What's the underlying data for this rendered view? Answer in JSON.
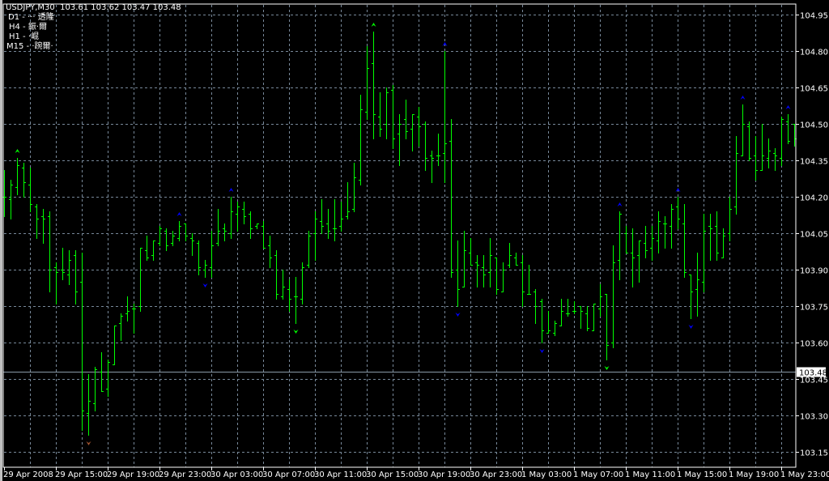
{
  "header": {
    "symbol_timeframe": "USDJPY,M30",
    "ohlc": "103.61 103.62 103.47 103.48"
  },
  "indicator_legend": [
    "D1 - ··· 透隆",
    "H4 - 鋠·爾",
    "H1 - ·崐",
    "M15 - ·踠爾·"
  ],
  "colors": {
    "background": "#000000",
    "bars": "#00ff00",
    "grid": "#778899",
    "axis": "#ffffff",
    "price_line": "#8a9aa8",
    "fractal_green": "#00ff00",
    "fractal_blue": "#0000ff",
    "fractal_brown": "#a0522d"
  },
  "price_axis": {
    "ticks": [
      "104.95",
      "104.80",
      "104.65",
      "104.50",
      "104.35",
      "104.20",
      "104.05",
      "103.90",
      "103.75",
      "103.60",
      "103.45",
      "103.30",
      "103.15"
    ],
    "current_price": "103.48"
  },
  "time_axis": {
    "labels": [
      "29 Apr 2008",
      "29 Apr 15:00",
      "29 Apr 19:00",
      "29 Apr 23:00",
      "30 Apr 03:00",
      "30 Apr 07:00",
      "30 Apr 11:00",
      "30 Apr 15:00",
      "30 Apr 19:00",
      "30 Apr 23:00",
      "1 May 03:00",
      "1 May 07:00",
      "1 May 11:00",
      "1 May 15:00",
      "1 May 19:00",
      "1 May 23:00"
    ],
    "bars_per_label": 8
  },
  "chart_data": {
    "type": "ohlc",
    "ylim": [
      103.15,
      104.95
    ],
    "grid": true,
    "bar_fields": [
      "open",
      "high",
      "low",
      "close"
    ],
    "bars": [
      [
        104.2,
        104.31,
        104.12,
        104.2
      ],
      [
        104.19,
        104.27,
        104.11,
        104.25
      ],
      [
        104.24,
        104.36,
        104.21,
        104.33
      ],
      [
        104.32,
        104.34,
        104.2,
        104.26
      ],
      [
        104.25,
        104.32,
        104.14,
        104.17
      ],
      [
        104.16,
        104.17,
        104.03,
        104.11
      ],
      [
        104.12,
        104.15,
        104.01,
        104.11
      ],
      [
        104.12,
        104.14,
        103.81,
        103.9
      ],
      [
        103.91,
        103.93,
        103.76,
        103.89
      ],
      [
        103.9,
        103.99,
        103.86,
        103.89
      ],
      [
        103.88,
        103.98,
        103.84,
        103.94
      ],
      [
        103.96,
        103.98,
        103.76,
        103.81
      ],
      [
        103.85,
        103.97,
        103.24,
        103.32
      ],
      [
        103.31,
        103.47,
        103.22,
        103.36
      ],
      [
        103.35,
        103.5,
        103.32,
        103.49
      ],
      [
        103.48,
        103.56,
        103.4,
        103.4
      ],
      [
        103.41,
        103.53,
        103.38,
        103.52
      ],
      [
        103.51,
        103.67,
        103.51,
        103.67
      ],
      [
        103.68,
        103.72,
        103.61,
        103.71
      ],
      [
        103.72,
        103.79,
        103.69,
        103.73
      ],
      [
        103.74,
        103.76,
        103.64,
        103.74
      ],
      [
        103.75,
        103.99,
        103.73,
        103.99
      ],
      [
        103.98,
        104.04,
        103.94,
        103.95
      ],
      [
        103.96,
        104.02,
        103.94,
        104.02
      ],
      [
        104.01,
        104.08,
        104.0,
        104.07
      ],
      [
        104.06,
        104.07,
        103.98,
        104.0
      ],
      [
        104.01,
        104.06,
        104.0,
        104.04
      ],
      [
        104.03,
        104.1,
        104.02,
        104.08
      ],
      [
        104.09,
        104.09,
        104.02,
        104.04
      ],
      [
        104.03,
        104.05,
        103.96,
        104.02
      ],
      [
        104.01,
        104.02,
        103.88,
        103.91
      ],
      [
        103.9,
        103.94,
        103.87,
        103.92
      ],
      [
        103.91,
        104.06,
        103.87,
        104.0
      ],
      [
        104.01,
        104.15,
        104.0,
        104.06
      ],
      [
        104.07,
        104.09,
        104.02,
        104.06
      ],
      [
        104.05,
        104.2,
        104.03,
        104.14
      ],
      [
        104.13,
        104.18,
        104.06,
        104.16
      ],
      [
        104.15,
        104.18,
        104.09,
        104.12
      ],
      [
        104.13,
        104.14,
        104.03,
        104.07
      ],
      [
        104.08,
        104.09,
        104.07,
        104.09
      ],
      [
        104.08,
        104.1,
        103.99,
        103.99
      ],
      [
        104.0,
        104.04,
        103.91,
        103.95
      ],
      [
        103.96,
        103.98,
        103.78,
        103.8
      ],
      [
        103.79,
        103.9,
        103.78,
        103.83
      ],
      [
        103.82,
        103.86,
        103.73,
        103.78
      ],
      [
        103.79,
        103.87,
        103.68,
        103.79
      ],
      [
        103.78,
        103.93,
        103.76,
        103.91
      ],
      [
        103.92,
        104.06,
        103.91,
        104.04
      ],
      [
        104.05,
        104.14,
        103.94,
        104.11
      ],
      [
        104.1,
        104.19,
        104.05,
        104.08
      ],
      [
        104.09,
        104.15,
        104.03,
        104.06
      ],
      [
        104.07,
        104.19,
        104.02,
        104.07
      ],
      [
        104.08,
        104.18,
        104.06,
        104.11
      ],
      [
        104.12,
        104.26,
        104.11,
        104.14
      ],
      [
        104.15,
        104.34,
        104.14,
        104.28
      ],
      [
        104.27,
        104.62,
        104.25,
        104.56
      ],
      [
        104.55,
        104.82,
        104.52,
        104.73
      ],
      [
        104.75,
        104.88,
        104.44,
        104.54
      ],
      [
        104.53,
        104.63,
        104.45,
        104.48
      ],
      [
        104.5,
        104.65,
        104.44,
        104.63
      ],
      [
        104.64,
        104.66,
        104.4,
        104.44
      ],
      [
        104.46,
        104.54,
        104.33,
        104.5
      ],
      [
        104.52,
        104.6,
        104.44,
        104.47
      ],
      [
        104.48,
        104.54,
        104.39,
        104.54
      ],
      [
        104.53,
        104.57,
        104.41,
        104.49
      ],
      [
        104.5,
        104.51,
        104.31,
        104.36
      ],
      [
        104.37,
        104.39,
        104.26,
        104.36
      ],
      [
        104.37,
        104.46,
        104.33,
        104.37
      ],
      [
        104.38,
        104.8,
        104.26,
        104.42
      ],
      [
        104.43,
        104.52,
        103.87,
        103.89
      ],
      [
        103.9,
        104.02,
        103.75,
        103.82
      ],
      [
        103.83,
        104.06,
        103.83,
        103.98
      ],
      [
        103.97,
        104.03,
        103.92,
        103.92
      ],
      [
        103.93,
        103.96,
        103.83,
        103.92
      ],
      [
        103.91,
        103.96,
        103.83,
        103.88
      ],
      [
        103.89,
        104.03,
        103.83,
        103.96
      ],
      [
        103.95,
        103.95,
        103.8,
        103.82
      ],
      [
        103.81,
        103.93,
        103.81,
        103.9
      ],
      [
        103.92,
        104.01,
        103.91,
        103.96
      ],
      [
        103.95,
        103.97,
        103.92,
        103.92
      ],
      [
        103.93,
        103.96,
        103.75,
        103.81
      ],
      [
        103.8,
        103.92,
        103.8,
        103.8
      ],
      [
        103.81,
        103.82,
        103.68,
        103.75
      ],
      [
        103.77,
        103.78,
        103.6,
        103.65
      ],
      [
        103.64,
        103.73,
        103.64,
        103.65
      ],
      [
        103.64,
        103.69,
        103.63,
        103.68
      ],
      [
        103.67,
        103.78,
        103.67,
        103.73
      ],
      [
        103.72,
        103.78,
        103.71,
        103.72
      ],
      [
        103.73,
        103.77,
        103.72,
        103.73
      ],
      [
        103.75,
        103.75,
        103.66,
        103.73
      ],
      [
        103.72,
        103.75,
        103.65,
        103.66
      ],
      [
        103.65,
        103.76,
        103.65,
        103.76
      ],
      [
        103.74,
        103.84,
        103.71,
        103.79
      ],
      [
        103.8,
        103.8,
        103.53,
        103.59
      ],
      [
        103.6,
        104.0,
        103.58,
        103.93
      ],
      [
        103.94,
        104.14,
        103.86,
        104.13
      ],
      [
        104.05,
        104.08,
        103.97,
        103.97
      ],
      [
        103.97,
        104.07,
        103.83,
        103.95
      ],
      [
        103.96,
        104.02,
        103.85,
        104.02
      ],
      [
        104.01,
        104.08,
        103.95,
        103.98
      ],
      [
        103.99,
        104.08,
        103.94,
        104.03
      ],
      [
        104.02,
        104.14,
        103.97,
        104.1
      ],
      [
        104.09,
        104.12,
        103.99,
        104.09
      ],
      [
        104.08,
        104.17,
        103.99,
        104.15
      ],
      [
        104.16,
        104.2,
        104.07,
        104.11
      ],
      [
        104.09,
        104.17,
        103.87,
        103.89
      ],
      [
        103.88,
        103.88,
        103.7,
        103.81
      ],
      [
        103.82,
        103.97,
        103.71,
        103.86
      ],
      [
        103.85,
        104.13,
        103.81,
        104.06
      ],
      [
        104.08,
        104.13,
        103.94,
        104.07
      ],
      [
        104.08,
        104.14,
        103.94,
        103.97
      ],
      [
        103.95,
        104.07,
        103.95,
        104.04
      ],
      [
        104.05,
        104.2,
        104.02,
        104.15
      ],
      [
        104.16,
        104.45,
        104.13,
        104.38
      ],
      [
        104.37,
        104.58,
        104.37,
        104.5
      ],
      [
        104.49,
        104.51,
        104.35,
        104.36
      ],
      [
        104.37,
        104.45,
        104.27,
        104.31
      ],
      [
        104.31,
        104.5,
        104.31,
        104.37
      ],
      [
        104.36,
        104.44,
        104.32,
        104.39
      ],
      [
        104.38,
        104.4,
        104.31,
        104.37
      ],
      [
        104.36,
        104.53,
        104.33,
        104.52
      ],
      [
        104.51,
        104.54,
        104.42,
        104.43
      ],
      [
        104.5,
        104.5,
        104.41,
        104.44
      ]
    ],
    "fractals": [
      {
        "bar": 2,
        "dir": "up",
        "color": "green"
      },
      {
        "bar": 13,
        "dir": "down",
        "color": "brown"
      },
      {
        "bar": 27,
        "dir": "up",
        "color": "blue"
      },
      {
        "bar": 31,
        "dir": "down",
        "color": "blue"
      },
      {
        "bar": 35,
        "dir": "up",
        "color": "blue"
      },
      {
        "bar": 45,
        "dir": "down",
        "color": "green"
      },
      {
        "bar": 57,
        "dir": "up",
        "color": "green"
      },
      {
        "bar": 68,
        "dir": "up",
        "color": "blue"
      },
      {
        "bar": 70,
        "dir": "down",
        "color": "blue"
      },
      {
        "bar": 83,
        "dir": "down",
        "color": "blue"
      },
      {
        "bar": 93,
        "dir": "down",
        "color": "green"
      },
      {
        "bar": 95,
        "dir": "up",
        "color": "blue"
      },
      {
        "bar": 104,
        "dir": "up",
        "color": "blue"
      },
      {
        "bar": 106,
        "dir": "down",
        "color": "blue"
      },
      {
        "bar": 114,
        "dir": "up",
        "color": "blue"
      },
      {
        "bar": 121,
        "dir": "up",
        "color": "blue"
      }
    ]
  }
}
